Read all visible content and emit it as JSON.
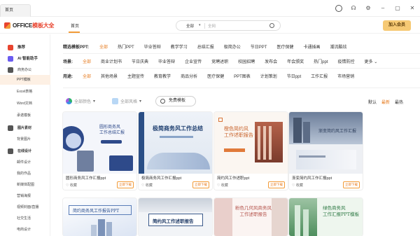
{
  "titlebar": {
    "tab": "首页"
  },
  "header": {
    "logo_office": "OFFICE",
    "logo_rest": "模板大全",
    "nav_home": "首页",
    "search_category": "全部",
    "search_placeholder": "全网",
    "join_label": "加入会员"
  },
  "sidebar": {
    "items": [
      {
        "label": "推荐"
      },
      {
        "label": "AI 智能助手"
      },
      {
        "label": "商务办公"
      },
      {
        "label": "PPT模板"
      },
      {
        "label": "Excel表格"
      },
      {
        "label": "Word文档"
      },
      {
        "label": "承诺模板"
      },
      {
        "label": "图片素材"
      },
      {
        "label": "背景图片"
      },
      {
        "label": "在线设计"
      },
      {
        "label": "邮件设计"
      },
      {
        "label": "我的作品"
      },
      {
        "label": "新媒体配图"
      },
      {
        "label": "营销海报"
      },
      {
        "label": "视频封面/直播"
      },
      {
        "label": "社交生活"
      },
      {
        "label": "电商设计"
      }
    ]
  },
  "filters": {
    "row1": {
      "label": "精选模板PPT:",
      "items": [
        "全部",
        "热门PPT",
        "毕业答辩",
        "教学学习",
        "总结汇报",
        "极简办公",
        "节日PPT",
        "医疗保健",
        "卡通插画",
        "潮流酷炫"
      ]
    },
    "row2": {
      "label": "场景:",
      "items": [
        "全部",
        "商业计划书",
        "节日庆典",
        "毕业答辩",
        "企业宣传",
        "竞聘述职",
        "校园招聘",
        "发布会",
        "年会颁奖",
        "热门ppt",
        "疫情防控",
        "更多"
      ]
    },
    "row3": {
      "label": "用途:",
      "items": [
        "全部",
        "其他场景",
        "主题宣传",
        "教育教学",
        "商品分析",
        "医疗保健",
        "PPT图表",
        "计划策划",
        "节日ppt",
        "工作汇报",
        "市场营销"
      ]
    }
  },
  "toolbar": {
    "color_label": "全部颜色",
    "style_label": "全部风格",
    "free_label": "免费模板",
    "sort": [
      "默认",
      "最新",
      "最热"
    ]
  },
  "cards": [
    {
      "title": "圆形商务风工作汇报ppt",
      "fav": "收藏",
      "dl": "立即下载",
      "thumb": "圆形商务风\n工作总结汇报"
    },
    {
      "title": "极简商务风工作汇报ppt",
      "fav": "收藏",
      "dl": "立即下载",
      "thumb": "极简商务风工作总结"
    },
    {
      "title": "简约风工作述职ppt",
      "fav": "收藏",
      "dl": "立即下载",
      "thumb": "橙色简约风\n工作述职报告"
    },
    {
      "title": "渐变简约风工作汇报ppt",
      "fav": "收藏",
      "dl": "立即下载",
      "thumb": "渐变简约风工作汇报"
    },
    {
      "thumb": "简约商务风工作报告PPT"
    },
    {
      "thumb": "简约风工作述职报告"
    },
    {
      "thumb": "粉色几何风商务风\n工作述职报告"
    },
    {
      "thumb": "绿色商务风\n工作汇报PPT模板"
    }
  ],
  "colors": {
    "accent": "#e67a1e",
    "brand_red": "#e8442f",
    "gold": "#f6c974"
  }
}
